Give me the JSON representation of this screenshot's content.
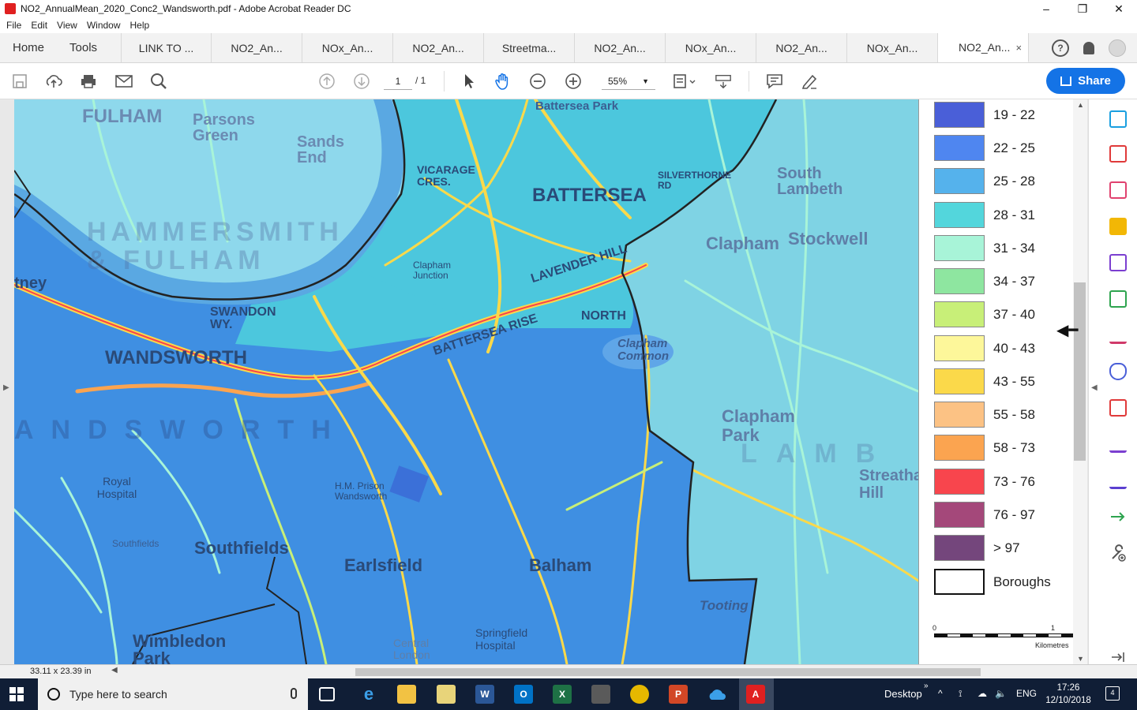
{
  "window": {
    "title": "NO2_AnnualMean_2020_Conc2_Wandsworth.pdf - Adobe Acrobat Reader DC",
    "minimize": "–",
    "restore": "❐",
    "close": "✕"
  },
  "menu": [
    "File",
    "Edit",
    "View",
    "Window",
    "Help"
  ],
  "nav": {
    "home": "Home",
    "tools": "Tools"
  },
  "tabs": [
    {
      "label": "LINK TO ..."
    },
    {
      "label": "NO2_An..."
    },
    {
      "label": "NOx_An..."
    },
    {
      "label": "NO2_An..."
    },
    {
      "label": "Streetma..."
    },
    {
      "label": "NO2_An..."
    },
    {
      "label": "NOx_An..."
    },
    {
      "label": "NO2_An..."
    },
    {
      "label": "NOx_An..."
    },
    {
      "label": "NO2_An...",
      "active": true,
      "close": "×"
    }
  ],
  "toolbar": {
    "page_current": "1",
    "page_total": "/ 1",
    "zoom": "55%",
    "share_label": "Share"
  },
  "map": {
    "labels": {
      "fulham": "FULHAM",
      "parsons_green": "Parsons Green",
      "sands_end": "Sands End",
      "battersea": "BATTERSEA",
      "battersea_park": "Battersea Park",
      "wandsworth": "WANDSWORTH",
      "putney": "tney",
      "swandon": "SWANDON WY.",
      "clapham": "Clapham",
      "stockwell": "Stockwell",
      "south_lambeth": "South Lambeth",
      "clapham_common": "Clapham Common",
      "clapham_park": "Clapham Park",
      "southfields": "Southfields",
      "earlsfield": "Earlsfield",
      "balham": "Balham",
      "royal_hospital": "Royal Hospital",
      "wimbledon_park": "Wimbledon Park",
      "tooting": "Tooting",
      "streatham_hill": "Streatham Hill",
      "springfield_hospital": "Springfield Hospital",
      "central_london": "Central London",
      "hammersmith": "HAMMERSMITH & FULHAM",
      "wandsworth_big": "ANDSWORTH",
      "lambeth_big": "LAMB",
      "vicarage": "VICARAGE CRES.",
      "battersea_rise": "BATTERSEA RISE",
      "lavender_hill": "LAVENDER HILL",
      "north": "NORTH",
      "hm_prison": "H.M. Prison Wandsworth",
      "clapham_junction": "Clapham Junction",
      "silverthorne": "SILVERTHORNE RD"
    }
  },
  "legend": {
    "items": [
      {
        "label": "19 - 22",
        "color": "#4a5fd8"
      },
      {
        "label": "22 - 25",
        "color": "#4f86f0"
      },
      {
        "label": "25 - 28",
        "color": "#55b2ec"
      },
      {
        "label": "28 - 31",
        "color": "#53d6dc"
      },
      {
        "label": "31 - 34",
        "color": "#a8f4d8"
      },
      {
        "label": "34 - 37",
        "color": "#8ee6a0"
      },
      {
        "label": "37 - 40",
        "color": "#c8ef78"
      },
      {
        "label": "40 - 43",
        "color": "#fdf79a"
      },
      {
        "label": "43 - 55",
        "color": "#fbd94a"
      },
      {
        "label": "55 - 58",
        "color": "#fcc284"
      },
      {
        "label": "58 - 73",
        "color": "#fba450"
      },
      {
        "label": "73 - 76",
        "color": "#f8454d"
      },
      {
        "label": "76 - 97",
        "color": "#a4487a"
      },
      {
        "label": "> 97",
        "color": "#74467c"
      }
    ],
    "boroughs_label": "Boroughs",
    "scale_zero": "0",
    "scale_one": "1",
    "scale_unit": "Kilometres"
  },
  "status": {
    "page_size": "33.11 x 23.39 in"
  },
  "taskbar": {
    "search_placeholder": "Type here to search",
    "desktop_label": "Desktop",
    "lang": "ENG",
    "time": "17:26",
    "date": "12/10/2018",
    "notifications": "4"
  }
}
